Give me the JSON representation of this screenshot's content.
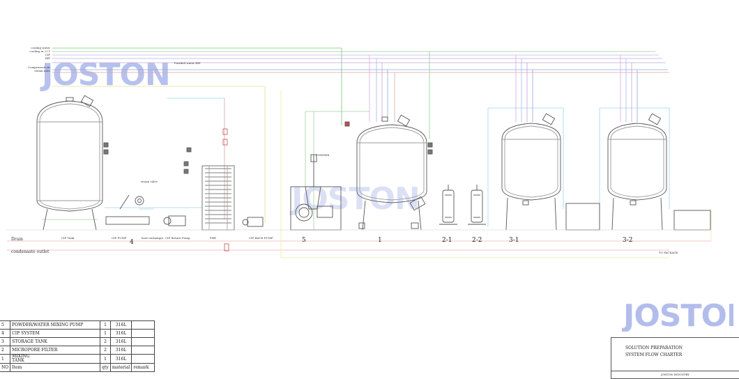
{
  "watermark": "JOSTON",
  "utility_lines": {
    "cooling_water": "cooling water",
    "cooling_in_2": "cooling in 2+1",
    "cip": "CIP",
    "cip_return": "RIP",
    "compressed_air": "Compressed air",
    "steam_inlet": "steam inlet",
    "purified_water": "Purified water RIP",
    "drain": "Drain",
    "condensate_outlet": "condensate outlet",
    "to_package": "TO PACKAGE"
  },
  "component_labels": {
    "cip_tank": "CIP Tank",
    "cip_pump": "CIP PUMP",
    "heat_exchanger": "heat exchanger",
    "cip_return_pump": "CIP Return Pump",
    "plate_hx": "PHE",
    "cip_back_pump": "CIP BACK PUMP",
    "steam_valve": "steam valve",
    "powder": "POWDER"
  },
  "section_numbers": [
    "4",
    "5",
    "1",
    "2-1",
    "2-2",
    "3-1",
    "3-2"
  ],
  "parts_table": {
    "rows": [
      {
        "no": "5",
        "item": "POWDER/WATER  MIXING PUMP",
        "qty": "1",
        "material": "316L",
        "remark": ""
      },
      {
        "no": "4",
        "item": "CIP SYSTEM",
        "qty": "1",
        "material": "316L",
        "remark": ""
      },
      {
        "no": "3",
        "item": "STORAGE TANK",
        "qty": "2",
        "material": "316L",
        "remark": ""
      },
      {
        "no": "2",
        "item": "MICROPORE FILTER",
        "qty": "2",
        "material": "316L",
        "remark": ""
      },
      {
        "no": "1",
        "item": "MIXING",
        "item2": "TANK",
        "qty": "1",
        "material": "316L",
        "remark": ""
      }
    ],
    "header": {
      "no": "NO",
      "item": "Item",
      "qty": "qty",
      "material": "material",
      "remark": "remark"
    }
  },
  "title_block": {
    "line1": "SOLUTION PREPARATION",
    "line2": "SYSTEM FLOW CHARTER",
    "footer": "JOSTON INDUSTRY"
  }
}
